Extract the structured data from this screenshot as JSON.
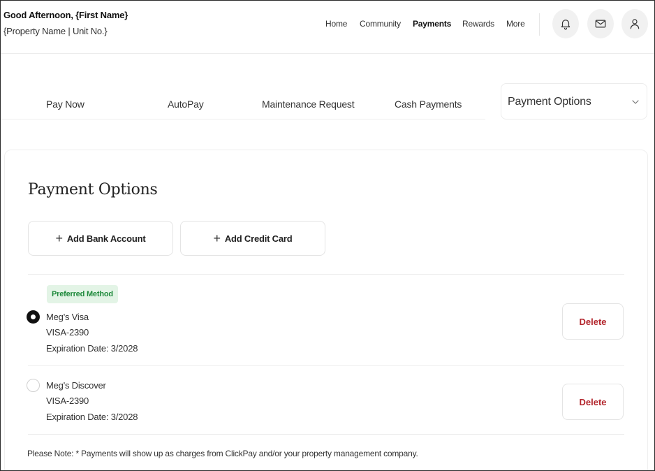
{
  "header": {
    "greeting": "Good Afternoon, {First Name}",
    "property": "{Property Name | Unit No.}",
    "nav": [
      {
        "label": "Home",
        "active": false
      },
      {
        "label": "Community",
        "active": false
      },
      {
        "label": "Payments",
        "active": true
      },
      {
        "label": "Rewards",
        "active": false
      },
      {
        "label": "More",
        "active": false
      }
    ],
    "icons": [
      "bell-icon",
      "mail-icon",
      "user-icon"
    ]
  },
  "tabs": [
    {
      "label": "Pay Now"
    },
    {
      "label": "AutoPay"
    },
    {
      "label": "Maintenance Request"
    },
    {
      "label": "Cash Payments"
    }
  ],
  "dropdown": {
    "selected": "Payment Options",
    "icon": "chevron-down-icon"
  },
  "main": {
    "title": "Payment Options",
    "add_bank_label": "Add Bank Account",
    "add_card_label": "Add Credit Card",
    "preferred_badge": "Preferred Method",
    "methods": [
      {
        "name": "Meg's Visa",
        "number": "VISA-2390",
        "expiration": "Expiration Date: 3/2028",
        "selected": true,
        "delete_label": "Delete"
      },
      {
        "name": "Meg's Discover",
        "number": "VISA-2390",
        "expiration": "Expiration Date: 3/2028",
        "selected": false,
        "delete_label": "Delete"
      }
    ],
    "note": "Please Note: * Payments will show up as charges from ClickPay and/or your property management company."
  },
  "colors": {
    "accent_delete": "#b3262d",
    "badge_bg": "#e3f4e6",
    "badge_text": "#1f8a3c",
    "icon_button_bg": "#f1f1f1"
  }
}
